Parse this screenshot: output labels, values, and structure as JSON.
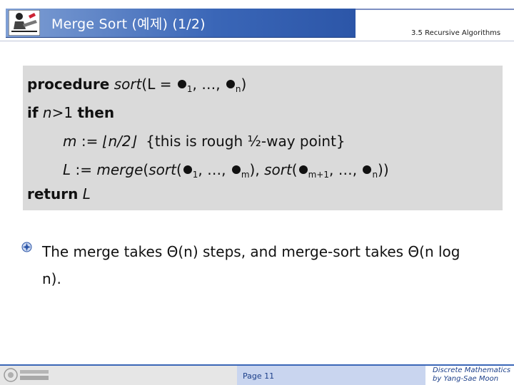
{
  "header": {
    "title": "Merge Sort (예제) (1/2)",
    "section": "3.5 Recursive Algorithms"
  },
  "code": {
    "kw_procedure": "procedure",
    "fn_sort": "sort",
    "open_L": "(L = ",
    "comma_ellipsis": ", …, ",
    "sub_1": "1",
    "sub_n": "n",
    "close_paren": ")",
    "kw_if": "if",
    "cond": "n",
    "cond_rest": ">1",
    "kw_then": "then",
    "assign_m": "m",
    "assign_op": " := ",
    "floor_expr": "⌊n/2⌋",
    "comment": "{this is rough ½-way point}",
    "assign_L": "L",
    "fn_merge": "merge",
    "fn_sort2": "sort",
    "sub_m": "m",
    "sub_m1": "m+1",
    "kw_return": "return",
    "ret_L": "L"
  },
  "bullet": {
    "text_1": "The merge takes ",
    "theta_n": "Θ(n)",
    "text_2": " steps, and merge-sort takes ",
    "theta_nlogn": "Θ(n log n)",
    "text_3": "."
  },
  "footer": {
    "page": "Page 11",
    "course_line1": "Discrete Mathematics",
    "course_line2": "by Yang-Sae Moon"
  },
  "colors": {
    "title_bar": "#3a66b7",
    "code_box": "#dadada",
    "footer_accent": "#1c3f8a"
  }
}
